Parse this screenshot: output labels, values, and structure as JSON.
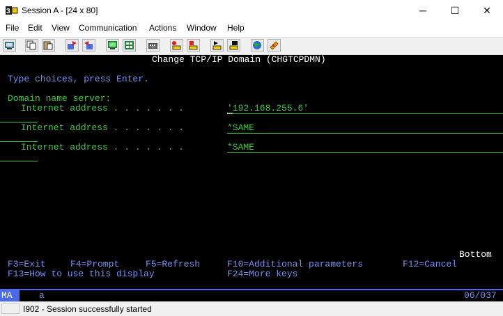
{
  "window": {
    "title": "Session A - [24 x 80]",
    "controls": {
      "minimize": "─",
      "maximize": "☐",
      "close": "✕"
    }
  },
  "menu": [
    "File",
    "Edit",
    "View",
    "Communication",
    "Actions",
    "Window",
    "Help"
  ],
  "toolbar": {
    "buttons": [
      "print-screen-icon",
      "copy-icon",
      "paste-icon",
      "send-file-icon",
      "receive-file-icon",
      "display-icon",
      "keypad-icon",
      "keyboard-icon",
      "record-macro-icon",
      "stop-macro-icon",
      "play-macro-icon",
      "macro-icon",
      "globe-icon",
      "help-icon"
    ]
  },
  "terminal": {
    "screen_title": "Change TCP/IP Domain (CHGTCPDMN)",
    "instruction": "Type choices, press Enter.",
    "section_label": "Domain name server:",
    "fields": [
      {
        "label": "Internet address . . . . . . .",
        "value": "'192.168.255.6'"
      },
      {
        "label": "Internet address . . . . . . .",
        "value": "*SAME"
      },
      {
        "label": "Internet address . . . . . . .",
        "value": "*SAME"
      }
    ],
    "more_indicator": "Bottom",
    "fkeys_row1": [
      "F3=Exit",
      "F4=Prompt",
      "F5=Refresh",
      "F10=Additional parameters",
      "F12=Cancel"
    ],
    "fkeys_row2": [
      "F13=How to use this display",
      "F24=More keys"
    ]
  },
  "oia": {
    "mode": "MA",
    "indicator": "a",
    "cursor_position": "06/037"
  },
  "status": {
    "message": "I902 - Session successfully started"
  },
  "colors": {
    "screen_background": "#000000",
    "field_text": "#3ec83e",
    "prompt_text": "#7890f0",
    "oia_accent": "#4a6ae8"
  }
}
